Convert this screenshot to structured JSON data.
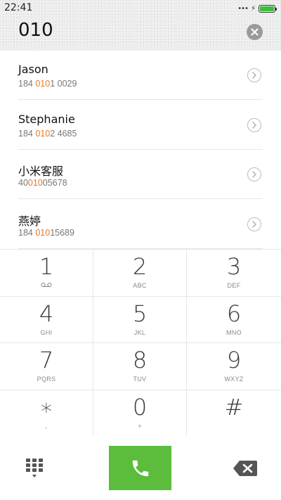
{
  "status_bar": {
    "time": "22:41",
    "signal": "•••",
    "charging": "⚡",
    "battery_level": 1.0
  },
  "dialer": {
    "number": "010"
  },
  "contacts": [
    {
      "name": "Jason",
      "number_pre": "184 ",
      "number_match": "010",
      "number_post": "1 0029"
    },
    {
      "name": "Stephanie",
      "number_pre": "184 ",
      "number_match": "010",
      "number_post": "2 4685"
    },
    {
      "name": "小米客服",
      "number_pre": "40",
      "number_match": "010",
      "number_post": "05678"
    },
    {
      "name": "燕婷",
      "number_pre": "184 ",
      "number_match": "010",
      "number_post": "15689"
    }
  ],
  "keypad": [
    {
      "digit": "1",
      "sub": ""
    },
    {
      "digit": "2",
      "sub": "ABC"
    },
    {
      "digit": "3",
      "sub": "DEF"
    },
    {
      "digit": "4",
      "sub": "GHI"
    },
    {
      "digit": "5",
      "sub": "JKL"
    },
    {
      "digit": "6",
      "sub": "MNO"
    },
    {
      "digit": "7",
      "sub": "PQRS"
    },
    {
      "digit": "8",
      "sub": "TUV"
    },
    {
      "digit": "9",
      "sub": "WXYZ"
    },
    {
      "digit": "∗",
      "sub": ","
    },
    {
      "digit": "0",
      "sub": "+"
    },
    {
      "digit": "#",
      "sub": ""
    }
  ],
  "icons": {
    "key_1_sub": "voicemail-icon",
    "clear": "clear-icon",
    "detail": "chevron-right-icon",
    "keypad_toggle": "dialpad-icon",
    "call": "phone-icon",
    "backspace": "backspace-icon"
  },
  "colors": {
    "accent_match": "#e87722",
    "call_green": "#5bbd3b",
    "battery_green": "#3cbf3c"
  }
}
